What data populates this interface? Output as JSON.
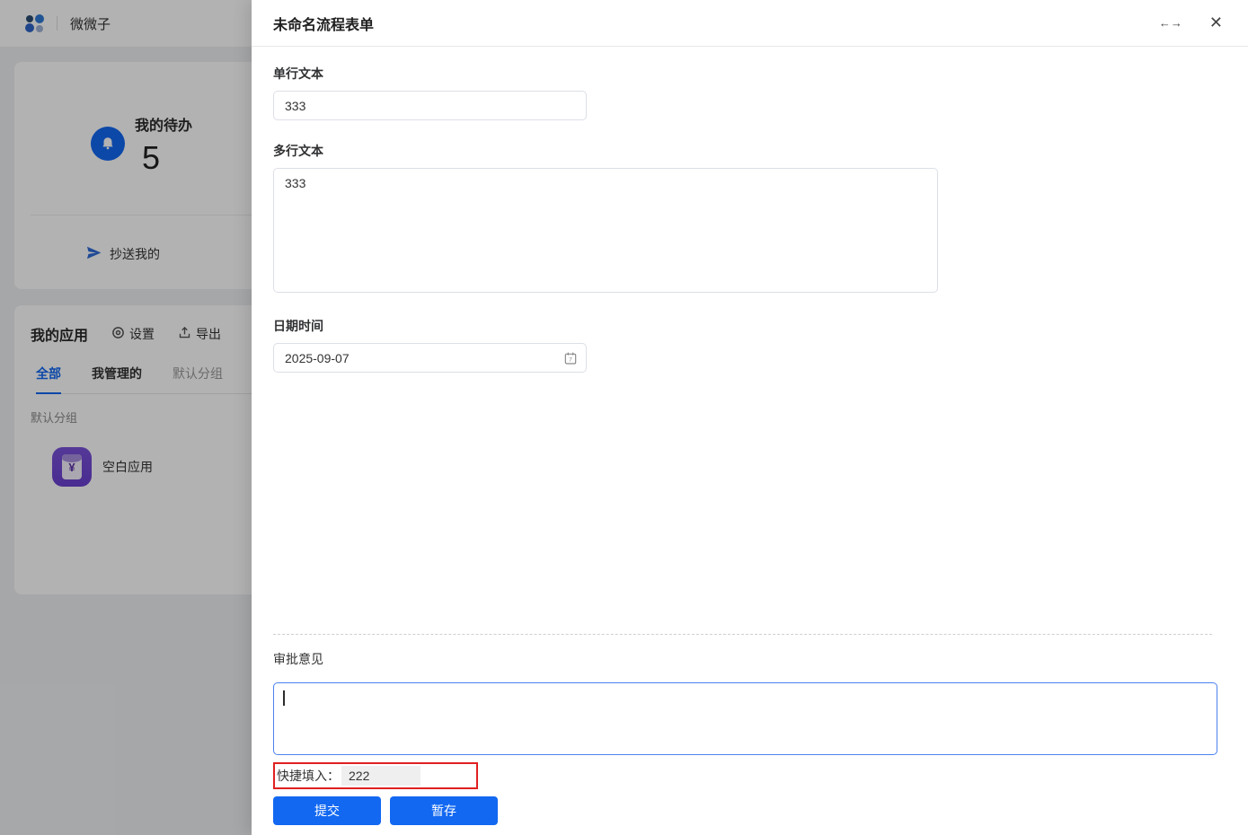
{
  "topbar": {
    "app_name": "微微子"
  },
  "sidebar": {
    "todo_card": {
      "title": "我的待办",
      "count": "5",
      "cc_label": "抄送我的"
    },
    "apps_card": {
      "title": "我的应用",
      "settings_label": "设置",
      "export_label": "导出",
      "tabs": [
        {
          "label": "全部",
          "active": true
        },
        {
          "label": "我管理的",
          "active": false
        },
        {
          "label": "默认分组",
          "active": false
        }
      ],
      "group_label": "默认分组",
      "apps": [
        {
          "name": "空白应用",
          "icon": "red-envelope",
          "icon_symbol": "¥"
        }
      ]
    }
  },
  "drawer": {
    "title": "未命名流程表单",
    "icons": {
      "expand": "←→",
      "close": "✕"
    },
    "fields": {
      "single_text": {
        "label": "单行文本",
        "value": "333"
      },
      "multi_text": {
        "label": "多行文本",
        "value": "333"
      },
      "datetime": {
        "label": "日期时间",
        "value": "2025-09-07",
        "icon_day": "7"
      }
    },
    "footer": {
      "approval_label": "审批意见",
      "approval_value": "",
      "quick_fill_label": "快捷填入：",
      "quick_fill_value": "222",
      "submit_label": "提交",
      "save_label": "暂存"
    }
  },
  "colors": {
    "primary_blue": "#1268f1",
    "focus_border": "#4b82f0",
    "highlight_red": "#e02020",
    "mask": "rgba(0,0,0,0.30)"
  }
}
